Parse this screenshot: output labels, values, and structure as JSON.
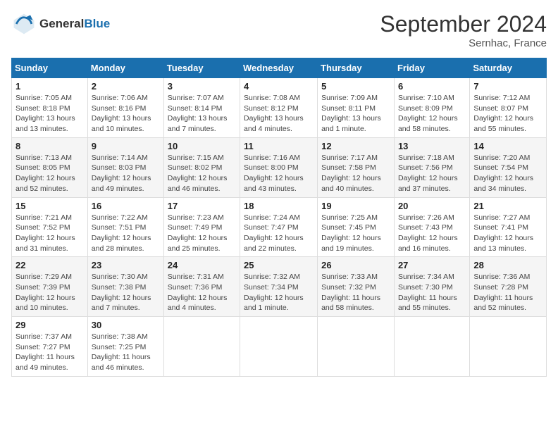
{
  "header": {
    "logo_line1": "General",
    "logo_line2": "Blue",
    "month": "September 2024",
    "location": "Sernhac, France"
  },
  "days_of_week": [
    "Sunday",
    "Monday",
    "Tuesday",
    "Wednesday",
    "Thursday",
    "Friday",
    "Saturday"
  ],
  "weeks": [
    [
      {
        "num": "1",
        "detail": "Sunrise: 7:05 AM\nSunset: 8:18 PM\nDaylight: 13 hours\nand 13 minutes."
      },
      {
        "num": "2",
        "detail": "Sunrise: 7:06 AM\nSunset: 8:16 PM\nDaylight: 13 hours\nand 10 minutes."
      },
      {
        "num": "3",
        "detail": "Sunrise: 7:07 AM\nSunset: 8:14 PM\nDaylight: 13 hours\nand 7 minutes."
      },
      {
        "num": "4",
        "detail": "Sunrise: 7:08 AM\nSunset: 8:12 PM\nDaylight: 13 hours\nand 4 minutes."
      },
      {
        "num": "5",
        "detail": "Sunrise: 7:09 AM\nSunset: 8:11 PM\nDaylight: 13 hours\nand 1 minute."
      },
      {
        "num": "6",
        "detail": "Sunrise: 7:10 AM\nSunset: 8:09 PM\nDaylight: 12 hours\nand 58 minutes."
      },
      {
        "num": "7",
        "detail": "Sunrise: 7:12 AM\nSunset: 8:07 PM\nDaylight: 12 hours\nand 55 minutes."
      }
    ],
    [
      {
        "num": "8",
        "detail": "Sunrise: 7:13 AM\nSunset: 8:05 PM\nDaylight: 12 hours\nand 52 minutes."
      },
      {
        "num": "9",
        "detail": "Sunrise: 7:14 AM\nSunset: 8:03 PM\nDaylight: 12 hours\nand 49 minutes."
      },
      {
        "num": "10",
        "detail": "Sunrise: 7:15 AM\nSunset: 8:02 PM\nDaylight: 12 hours\nand 46 minutes."
      },
      {
        "num": "11",
        "detail": "Sunrise: 7:16 AM\nSunset: 8:00 PM\nDaylight: 12 hours\nand 43 minutes."
      },
      {
        "num": "12",
        "detail": "Sunrise: 7:17 AM\nSunset: 7:58 PM\nDaylight: 12 hours\nand 40 minutes."
      },
      {
        "num": "13",
        "detail": "Sunrise: 7:18 AM\nSunset: 7:56 PM\nDaylight: 12 hours\nand 37 minutes."
      },
      {
        "num": "14",
        "detail": "Sunrise: 7:20 AM\nSunset: 7:54 PM\nDaylight: 12 hours\nand 34 minutes."
      }
    ],
    [
      {
        "num": "15",
        "detail": "Sunrise: 7:21 AM\nSunset: 7:52 PM\nDaylight: 12 hours\nand 31 minutes."
      },
      {
        "num": "16",
        "detail": "Sunrise: 7:22 AM\nSunset: 7:51 PM\nDaylight: 12 hours\nand 28 minutes."
      },
      {
        "num": "17",
        "detail": "Sunrise: 7:23 AM\nSunset: 7:49 PM\nDaylight: 12 hours\nand 25 minutes."
      },
      {
        "num": "18",
        "detail": "Sunrise: 7:24 AM\nSunset: 7:47 PM\nDaylight: 12 hours\nand 22 minutes."
      },
      {
        "num": "19",
        "detail": "Sunrise: 7:25 AM\nSunset: 7:45 PM\nDaylight: 12 hours\nand 19 minutes."
      },
      {
        "num": "20",
        "detail": "Sunrise: 7:26 AM\nSunset: 7:43 PM\nDaylight: 12 hours\nand 16 minutes."
      },
      {
        "num": "21",
        "detail": "Sunrise: 7:27 AM\nSunset: 7:41 PM\nDaylight: 12 hours\nand 13 minutes."
      }
    ],
    [
      {
        "num": "22",
        "detail": "Sunrise: 7:29 AM\nSunset: 7:39 PM\nDaylight: 12 hours\nand 10 minutes."
      },
      {
        "num": "23",
        "detail": "Sunrise: 7:30 AM\nSunset: 7:38 PM\nDaylight: 12 hours\nand 7 minutes."
      },
      {
        "num": "24",
        "detail": "Sunrise: 7:31 AM\nSunset: 7:36 PM\nDaylight: 12 hours\nand 4 minutes."
      },
      {
        "num": "25",
        "detail": "Sunrise: 7:32 AM\nSunset: 7:34 PM\nDaylight: 12 hours\nand 1 minute."
      },
      {
        "num": "26",
        "detail": "Sunrise: 7:33 AM\nSunset: 7:32 PM\nDaylight: 11 hours\nand 58 minutes."
      },
      {
        "num": "27",
        "detail": "Sunrise: 7:34 AM\nSunset: 7:30 PM\nDaylight: 11 hours\nand 55 minutes."
      },
      {
        "num": "28",
        "detail": "Sunrise: 7:36 AM\nSunset: 7:28 PM\nDaylight: 11 hours\nand 52 minutes."
      }
    ],
    [
      {
        "num": "29",
        "detail": "Sunrise: 7:37 AM\nSunset: 7:27 PM\nDaylight: 11 hours\nand 49 minutes."
      },
      {
        "num": "30",
        "detail": "Sunrise: 7:38 AM\nSunset: 7:25 PM\nDaylight: 11 hours\nand 46 minutes."
      },
      {
        "num": "",
        "detail": ""
      },
      {
        "num": "",
        "detail": ""
      },
      {
        "num": "",
        "detail": ""
      },
      {
        "num": "",
        "detail": ""
      },
      {
        "num": "",
        "detail": ""
      }
    ]
  ]
}
